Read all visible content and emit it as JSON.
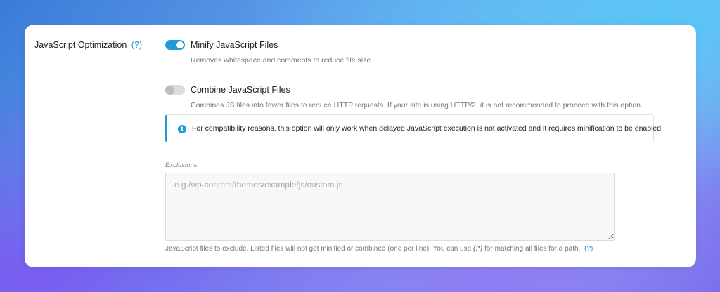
{
  "section": {
    "label": "JavaScript Optimization",
    "help": "(?)"
  },
  "minify": {
    "enabled": true,
    "title": "Minify JavaScript Files",
    "description": "Removes whitespace and comments to reduce file size"
  },
  "combine": {
    "enabled": false,
    "title": "Combine JavaScript Files",
    "description": "Combines JS files into fewer files to reduce HTTP requests. If your site is using HTTP/2, it is not recommended to proceed with this option."
  },
  "notice": {
    "icon": "info-icon",
    "text": "For compatibility reasons, this option will only work when delayed JavaScript execution is not activated and it requires minification to be enabled."
  },
  "exclusions": {
    "label": "Exclusions",
    "value": "",
    "placeholder": "e.g /wp-content/themes/example/js/custom.js",
    "help_before": "JavaScript files to exclude. Listed files will not get minified or combined (one per line). You can use ",
    "help_pattern": "(.*)",
    "help_after": " for matching all files for a path.",
    "help_link": "(?)"
  },
  "colors": {
    "accent": "#1e9bd8",
    "toggle_off": "#dcdcdc"
  }
}
